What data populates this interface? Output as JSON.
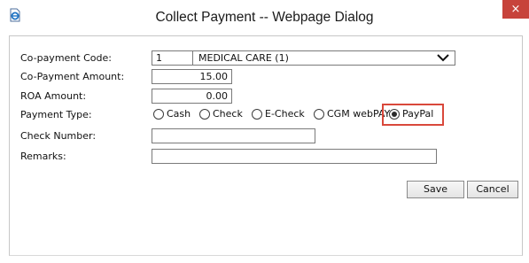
{
  "window": {
    "title": "Collect Payment -- Webpage Dialog",
    "close_glyph": "×",
    "icon": "ie-page-icon"
  },
  "form": {
    "copay_code": {
      "label": "Co-payment Code:",
      "number": "1",
      "selected": "MEDICAL CARE (1)"
    },
    "copay_amount": {
      "label": "Co-Payment Amount:",
      "value": "15.00"
    },
    "roa_amount": {
      "label": "ROA Amount:",
      "value": "0.00"
    },
    "payment_type": {
      "label": "Payment Type:",
      "options": [
        "Cash",
        "Check",
        "E-Check",
        "CGM webPAY",
        "PayPal"
      ],
      "selected": "PayPal"
    },
    "check_number": {
      "label": "Check Number:",
      "value": ""
    },
    "remarks": {
      "label": "Remarks:",
      "value": ""
    }
  },
  "buttons": {
    "save": "Save",
    "cancel": "Cancel"
  },
  "colors": {
    "highlight": "#d9483b",
    "close_bg": "#c7433b"
  }
}
